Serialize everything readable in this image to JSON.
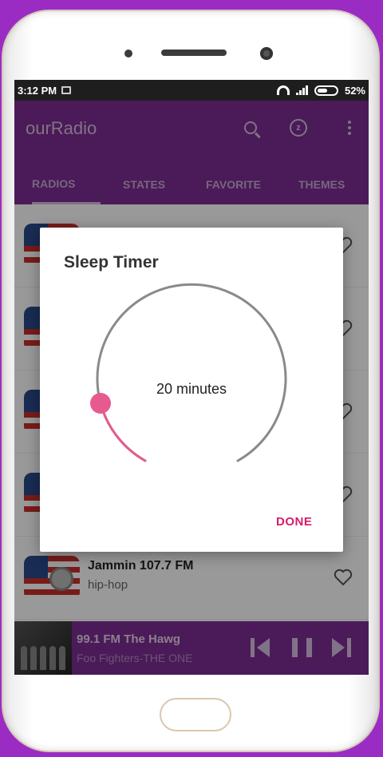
{
  "status_bar": {
    "time": "3:12 PM",
    "battery": "52%"
  },
  "app_bar": {
    "title": "ourRadio",
    "icons": [
      "search-icon",
      "alarm-icon",
      "more-vert-icon"
    ]
  },
  "tabs": [
    {
      "label": "RADIOS",
      "selected": true
    },
    {
      "label": "STATES",
      "selected": false
    },
    {
      "label": "FAVORITE",
      "selected": false
    },
    {
      "label": "THEMES",
      "selected": false
    }
  ],
  "stations": [
    {
      "name": "",
      "genre": ""
    },
    {
      "name": "",
      "genre": ""
    },
    {
      "name": "",
      "genre": ""
    },
    {
      "name": "",
      "genre": ""
    },
    {
      "name": "Jammin 107.7 FM",
      "genre": "hip-hop"
    }
  ],
  "player": {
    "station": "99.1 FM The Hawg",
    "track": "Foo Fighters-THE ONE",
    "controls": [
      "skip-previous-icon",
      "pause-icon",
      "skip-next-icon"
    ]
  },
  "dialog": {
    "title": "Sleep Timer",
    "value_label": "20 minutes",
    "value_minutes": 20,
    "done_label": "DONE"
  },
  "colors": {
    "background": "#9a2cc4",
    "app_bar": "#7c2e93",
    "accent": "#e75a8f",
    "done_text": "#d81b6a"
  }
}
